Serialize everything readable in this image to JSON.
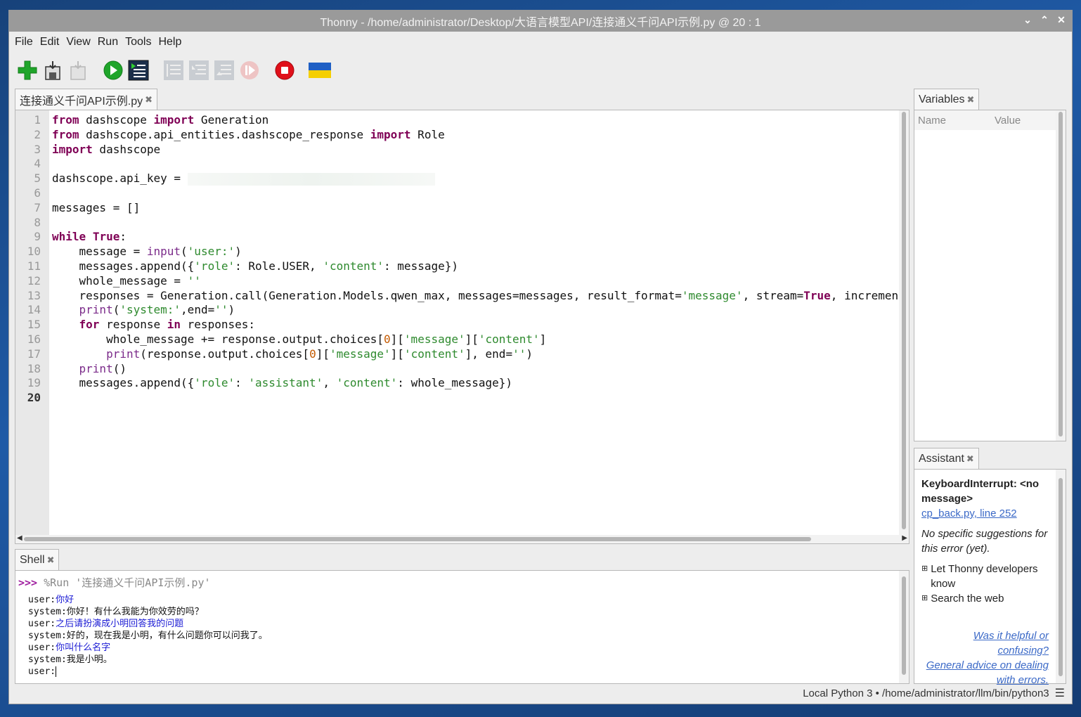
{
  "window": {
    "title": "Thonny  -  /home/administrator/Desktop/大语言模型API/连接通义千问API示例.py  @  20 : 1",
    "controls": [
      "⌄",
      "⌃",
      "✕"
    ]
  },
  "menu": [
    "File",
    "Edit",
    "View",
    "Run",
    "Tools",
    "Help"
  ],
  "toolbar": {
    "icons": [
      "new-file-icon",
      "save-file-icon",
      "save-disabled-icon",
      "run-icon",
      "debug-icon",
      "step-over-icon",
      "step-into-icon",
      "step-out-icon",
      "resume-icon",
      "stop-icon",
      "ukraine-flag-icon"
    ],
    "colors": {
      "accent_green": "#1fa52a",
      "stop_red": "#e0101a",
      "flag_blue": "#1f5fc4",
      "flag_yellow": "#f5cf00"
    }
  },
  "editor": {
    "tab_label": "连接通义千问API示例.py",
    "line_numbers": [
      "1",
      "2",
      "3",
      "4",
      "5",
      "6",
      "7",
      "8",
      "9",
      "10",
      "11",
      "12",
      "13",
      "14",
      "15",
      "16",
      "17",
      "18",
      "19",
      "20"
    ],
    "lines": [
      [
        [
          "kw",
          "from"
        ],
        [
          "t",
          " dashscope "
        ],
        [
          "kw",
          "import"
        ],
        [
          "t",
          " Generation"
        ]
      ],
      [
        [
          "kw",
          "from"
        ],
        [
          "t",
          " dashscope.api_entities.dashscope_response "
        ],
        [
          "kw",
          "import"
        ],
        [
          "t",
          " Role"
        ]
      ],
      [
        [
          "kw",
          "import"
        ],
        [
          "t",
          " dashscope"
        ]
      ],
      [],
      [
        [
          "t",
          "dashscope.api_key = "
        ]
      ],
      [],
      [
        [
          "t",
          "messages = []"
        ]
      ],
      [],
      [
        [
          "kw",
          "while"
        ],
        [
          "t",
          " "
        ],
        [
          "kw",
          "True"
        ],
        [
          "t",
          ":"
        ]
      ],
      [
        [
          "t",
          "    message = "
        ],
        [
          "bi",
          "input"
        ],
        [
          "t",
          "("
        ],
        [
          "st",
          "'user:'"
        ],
        [
          "t",
          ")"
        ]
      ],
      [
        [
          "t",
          "    messages.append({"
        ],
        [
          "st",
          "'role'"
        ],
        [
          "t",
          ": Role.USER, "
        ],
        [
          "st",
          "'content'"
        ],
        [
          "t",
          ": message})"
        ]
      ],
      [
        [
          "t",
          "    whole_message = "
        ],
        [
          "st",
          "''"
        ]
      ],
      [
        [
          "t",
          "    responses = Generation.call(Generation.Models.qwen_max, messages=messages, result_format="
        ],
        [
          "st",
          "'message'"
        ],
        [
          "t",
          ", stream="
        ],
        [
          "kw",
          "True"
        ],
        [
          "t",
          ", incrementa"
        ]
      ],
      [
        [
          "t",
          "    "
        ],
        [
          "bi",
          "print"
        ],
        [
          "t",
          "("
        ],
        [
          "st",
          "'system:'"
        ],
        [
          "t",
          ",end="
        ],
        [
          "st",
          "''"
        ],
        [
          "t",
          ")"
        ]
      ],
      [
        [
          "t",
          "    "
        ],
        [
          "kw",
          "for"
        ],
        [
          "t",
          " response "
        ],
        [
          "kw",
          "in"
        ],
        [
          "t",
          " responses:"
        ]
      ],
      [
        [
          "t",
          "        whole_message += response.output.choices["
        ],
        [
          "nm",
          "0"
        ],
        [
          "t",
          "]["
        ],
        [
          "st",
          "'message'"
        ],
        [
          "t",
          "]["
        ],
        [
          "st",
          "'content'"
        ],
        [
          "t",
          "]"
        ]
      ],
      [
        [
          "t",
          "        "
        ],
        [
          "bi",
          "print"
        ],
        [
          "t",
          "(response.output.choices["
        ],
        [
          "nm",
          "0"
        ],
        [
          "t",
          "]["
        ],
        [
          "st",
          "'message'"
        ],
        [
          "t",
          "]["
        ],
        [
          "st",
          "'content'"
        ],
        [
          "t",
          "], end="
        ],
        [
          "st",
          "''"
        ],
        [
          "t",
          ")"
        ]
      ],
      [
        [
          "t",
          "    "
        ],
        [
          "bi",
          "print"
        ],
        [
          "t",
          "()"
        ]
      ],
      [
        [
          "t",
          "    messages.append({"
        ],
        [
          "st",
          "'role'"
        ],
        [
          "t",
          ": "
        ],
        [
          "st",
          "'assistant'"
        ],
        [
          "t",
          ", "
        ],
        [
          "st",
          "'content'"
        ],
        [
          "t",
          ": whole_message})"
        ]
      ],
      []
    ]
  },
  "variables": {
    "tab_label": "Variables",
    "col_name": "Name",
    "col_value": "Value"
  },
  "shell": {
    "tab_label": "Shell",
    "prompt": ">>>",
    "run_command": " %Run '连接通义千问API示例.py'",
    "lines": [
      {
        "prefix": "user:",
        "text": "你好",
        "user": true
      },
      {
        "prefix": "system:",
        "text": "你好！有什么我能为你效劳的吗？",
        "user": false
      },
      {
        "prefix": "user:",
        "text": "之后请扮演成小明回答我的问题",
        "user": true
      },
      {
        "prefix": "system:",
        "text": "好的，现在我是小明，有什么问题你可以问我了。",
        "user": false
      },
      {
        "prefix": "user:",
        "text": "你叫什么名字",
        "user": true
      },
      {
        "prefix": "system:",
        "text": "我是小明。",
        "user": false
      },
      {
        "prefix": "user:",
        "text": "",
        "user": true
      }
    ]
  },
  "assistant": {
    "tab_label": "Assistant",
    "error_title": "KeyboardInterrupt: <no message>",
    "error_link": "cp_back.py, line 252",
    "no_suggestions": "No specific suggestions for this error (yet).",
    "expand_items": [
      "Let Thonny developers know",
      "Search the web"
    ],
    "feedback_link": "Was it helpful or confusing?",
    "advice_link": "General advice on dealing with errors."
  },
  "status": {
    "interpreter": "Local Python 3  •  /home/administrator/llm/bin/python3"
  }
}
